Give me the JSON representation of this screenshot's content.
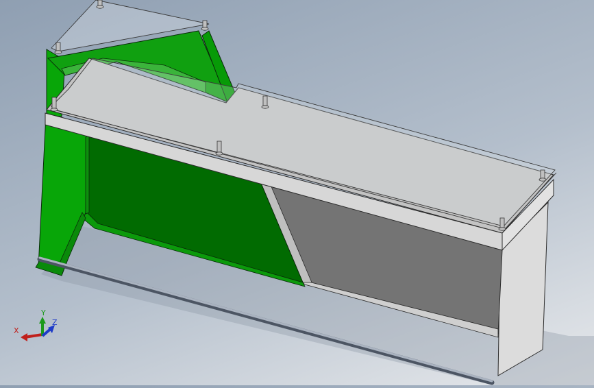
{
  "viewport": {
    "model_parts": [
      "green-side-panel",
      "gray-top-surface",
      "glass-cover",
      "gray-front-panel",
      "green-back-panel",
      "support-rod",
      "bolts"
    ],
    "colors": {
      "background_top": "#8f9fb2",
      "background_bottom": "#e6e8eb",
      "green_dark": "#016b01",
      "green_mid": "#08a608",
      "green_light": "#3bb43b",
      "gray_top": "#c3c3c3",
      "gray_panel": "#747474",
      "glass": "#dfe6ec"
    }
  },
  "triad": {
    "x_label": "X",
    "y_label": "Y",
    "z_label": "Z",
    "x_color": "#c0201c",
    "y_color": "#1c9a1c",
    "z_color": "#1f3cc8"
  }
}
